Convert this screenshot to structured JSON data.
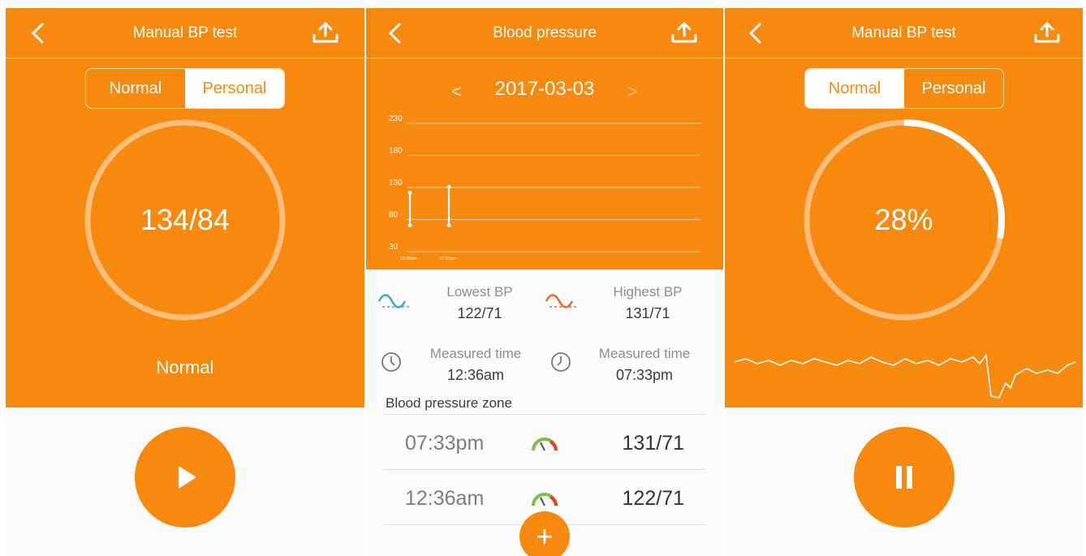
{
  "screen1": {
    "title": "Manual BP test",
    "mode_tabs": [
      "Normal",
      "Personal"
    ],
    "active_tab": "Personal",
    "reading": "134/84",
    "status": "Normal",
    "play_icon": "play-icon"
  },
  "screen2": {
    "title": "Blood pressure",
    "date": "2017-03-03",
    "prev_glyph": "<",
    "next_glyph": ">",
    "chart_data": {
      "type": "bar",
      "y_ticks": [
        "230",
        "180",
        "130",
        "80",
        "30"
      ],
      "ylim": [
        30,
        230
      ],
      "x_labels": [
        "12:36am",
        "07:33pm"
      ],
      "series": [
        {
          "low": 71,
          "high": 122
        },
        {
          "low": 71,
          "high": 131
        }
      ],
      "grid": true,
      "colors": {
        "line": "#ffffff",
        "background": "#f7890f"
      }
    },
    "lowest_label": "Lowest BP",
    "lowest_value": "122/71",
    "highest_label": "Highest BP",
    "highest_value": "131/71",
    "measured_label_1": "Measured time",
    "measured_value_1": "12:36am",
    "measured_label_2": "Measured time",
    "measured_value_2": "07:33pm",
    "zone_title": "Blood pressure zone",
    "rows": [
      {
        "time": "07:33pm",
        "value": "131/71",
        "icon": "gauge-icon"
      },
      {
        "time": "12:36am",
        "value": "122/71",
        "icon": "gauge-icon"
      }
    ],
    "fab_label": "+"
  },
  "screen3": {
    "title": "Manual BP test",
    "mode_tabs": [
      "Normal",
      "Personal"
    ],
    "active_tab": "Normal",
    "progress_text": "28%",
    "progress": 0.28,
    "pause_icon": "pause-icon"
  },
  "colors": {
    "accent": "#f7890f",
    "low_wave": "#35a8e0",
    "high_wave": "#f0642a",
    "gauge_green": "#7cc242",
    "gauge_red": "#e6412f"
  }
}
